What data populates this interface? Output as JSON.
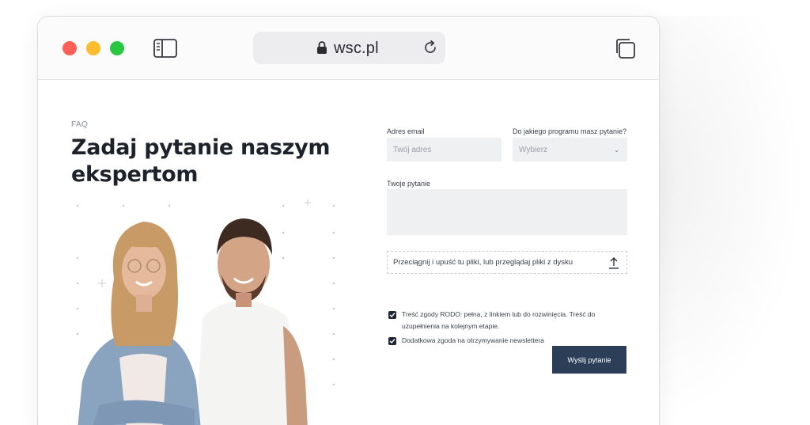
{
  "browser": {
    "url": "wsc.pl"
  },
  "page": {
    "eyebrow": "FAQ",
    "title": "Zadaj pytanie naszym ekspertom"
  },
  "form": {
    "email_label": "Adres email",
    "email_placeholder": "Twój adres",
    "program_label": "Do jakiego programu masz pytanie?",
    "program_selected": "Wybierz",
    "question_label": "Twoje pytanie",
    "dropzone_text": "Przeciągnij i upuść tu pliki, lub przeglądaj pliki z dysku",
    "consent_rodo": "Treść zgody RODO: pełna, z linkiem lub do rozwinięcia. Treść do uzupełnienia na kolejnym etapie.",
    "consent_newsletter": "Dodatkowa zgoda na otrzymywanie newslettera",
    "submit_label": "Wyślij pytanie"
  },
  "colors": {
    "accent": "#2c3e58",
    "field_bg": "#eff0f2",
    "title": "#1d222b"
  },
  "icons": [
    "lock-icon",
    "reload-icon",
    "sidebar-icon",
    "tabs-icon",
    "upload-icon",
    "checkmark-icon",
    "chevron-down-icon"
  ]
}
